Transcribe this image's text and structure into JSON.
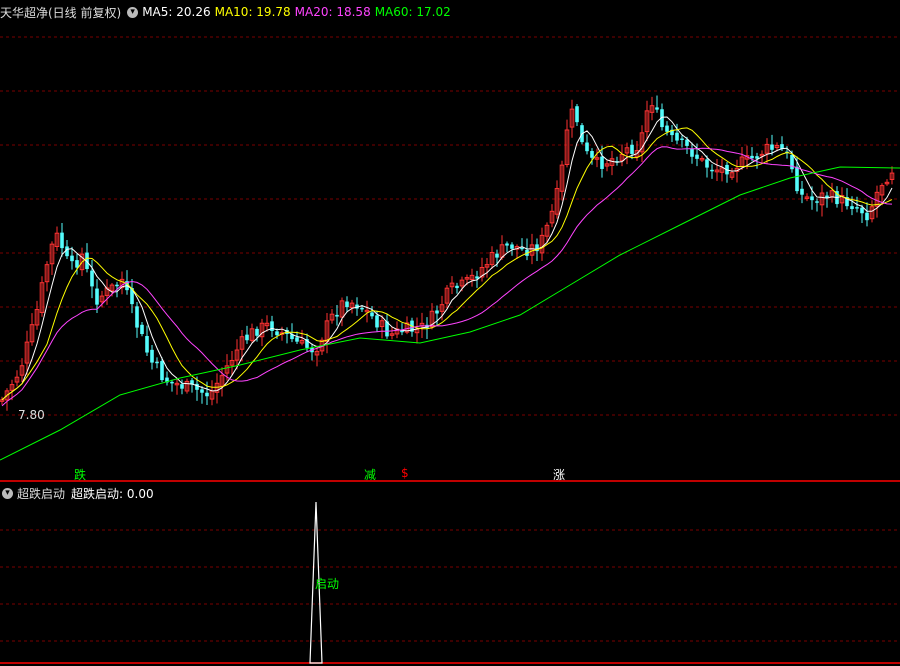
{
  "main_panel": {
    "title": "天华超净(日线 前复权)",
    "indicators": [
      {
        "label": "MA5: 20.26",
        "color": "#ffffff"
      },
      {
        "label": "MA10: 19.78",
        "color": "#ffff00"
      },
      {
        "label": "MA20: 18.58",
        "color": "#ff44ff"
      },
      {
        "label": "MA60: 17.02",
        "color": "#00ff00"
      }
    ],
    "low_price_label": "7.80",
    "signals": [
      {
        "text": "跌",
        "color": "#00ff00",
        "at": 75
      },
      {
        "text": "减",
        "color": "#00ff00",
        "at": 365
      },
      {
        "text": "$",
        "color": "#ff0000",
        "at": 402
      },
      {
        "text": "涨",
        "color": "#ffffff",
        "at": 555
      }
    ]
  },
  "sub_panel": {
    "title": "超跌启动",
    "value_label": "超跌启动: 0.00",
    "spike_label": "启动"
  },
  "colors": {
    "up": "#ff3232",
    "down": "#54fcfc",
    "grid": "#7a0000",
    "divider": "#ff0000"
  },
  "icons": [
    "collapse-icon",
    "collapse-icon"
  ]
}
